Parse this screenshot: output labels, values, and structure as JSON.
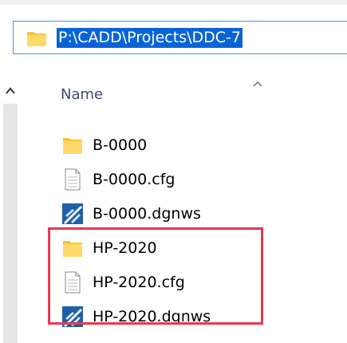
{
  "address_bar": {
    "path": "P:\\CADD\\Projects\\DDC-7"
  },
  "column_header": {
    "name_label": "Name"
  },
  "files": [
    {
      "name": "B-0000",
      "icon": "folder-icon"
    },
    {
      "name": "B-0000.cfg",
      "icon": "document-icon"
    },
    {
      "name": "B-0000.dgnws",
      "icon": "dgnws-file-icon"
    },
    {
      "name": "HP-2020",
      "icon": "folder-icon"
    },
    {
      "name": "HP-2020.cfg",
      "icon": "document-icon"
    },
    {
      "name": "HP-2020.dgnws",
      "icon": "dgnws-file-icon"
    }
  ],
  "colors": {
    "accent": "#0a64d8",
    "highlight_border": "#e8384f",
    "folder_yellow": "#f5c542",
    "header_text": "#3d4a6b"
  }
}
